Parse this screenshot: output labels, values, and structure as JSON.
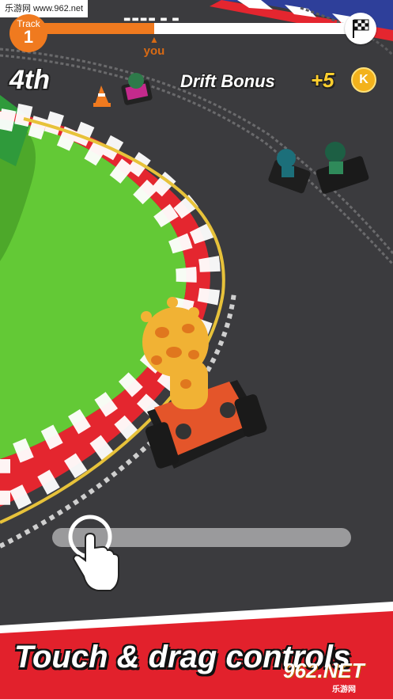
{
  "watermark_top": "乐游网 www.962.net",
  "hud": {
    "track_label": "Track",
    "track_number": "1",
    "race_progress_fraction": 0.38,
    "player_marker_label": "you",
    "position": "4th",
    "drift_bonus_label": "Drift Bonus",
    "drift_bonus_value": "+5",
    "coin_letter": "K"
  },
  "caption": "Touch & drag controls",
  "watermark_bottom": {
    "logo": "962.NET",
    "sub": "乐游网"
  },
  "colors": {
    "accent_orange": "#f07a1f",
    "coin_gold": "#f3b21c",
    "grass_green": "#63c936",
    "kerb_red": "#e4262f",
    "asphalt": "#3a3a3c"
  },
  "icons": {
    "finish": "checkered-flag-icon",
    "hand": "pointing-hand-icon",
    "coin": "k-coin-icon"
  }
}
